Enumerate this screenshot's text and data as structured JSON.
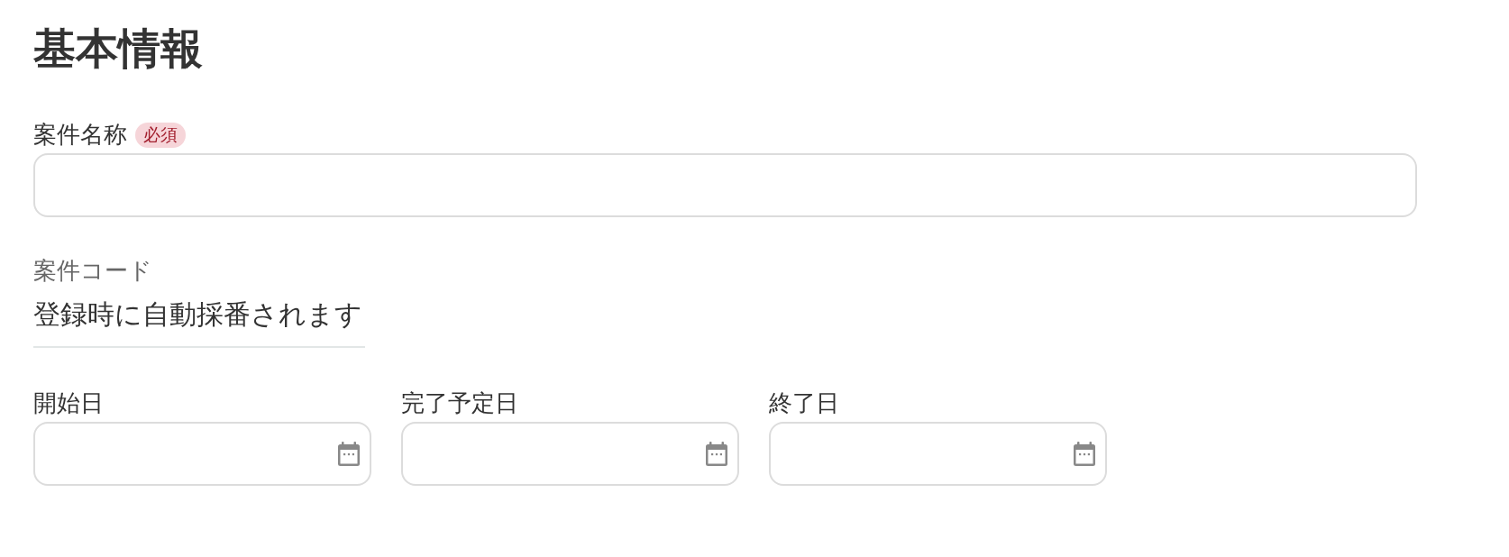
{
  "section_title": "基本情報",
  "project_name": {
    "label": "案件名称",
    "badge": "必須"
  },
  "project_code": {
    "label": "案件コード",
    "value": "登録時に自動採番されます"
  },
  "dates": [
    {
      "label": "開始日"
    },
    {
      "label": "完了予定日"
    },
    {
      "label": "終了日"
    }
  ]
}
